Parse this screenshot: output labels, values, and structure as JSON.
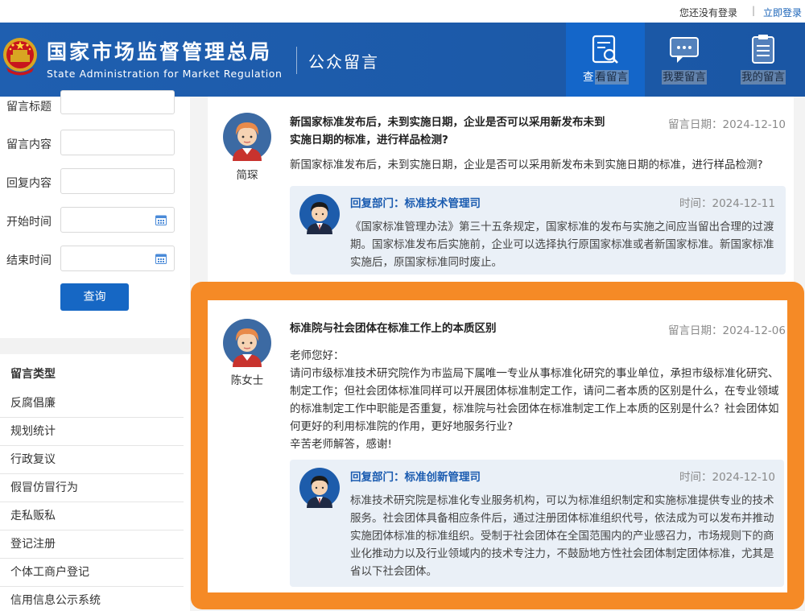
{
  "topbar": {
    "not_logged_in": "您还没有登录",
    "separator": "|",
    "login_link": "立即登录"
  },
  "header": {
    "title_cn": "国家市场监督管理总局",
    "title_en": "State Administration for Market Regulation",
    "section": "公众留言",
    "nav": [
      {
        "label_part1": "查",
        "label_part2": "看留言",
        "icon": "search-document-icon"
      },
      {
        "label": "我要留言",
        "icon": "chat-bubble-icon"
      },
      {
        "label": "我的留言",
        "icon": "list-document-icon"
      }
    ]
  },
  "sidebar": {
    "fields": [
      {
        "label": "留言标题",
        "type": "text"
      },
      {
        "label": "留言内容",
        "type": "text"
      },
      {
        "label": "回复内容",
        "type": "text"
      },
      {
        "label": "开始时间",
        "type": "date",
        "icon": "calendar-icon"
      },
      {
        "label": "结束时间",
        "type": "date",
        "icon": "calendar-icon"
      }
    ],
    "query_button": "查询",
    "types_title": "留言类型",
    "types": [
      "反腐倡廉",
      "规划统计",
      "行政复议",
      "假冒仿冒行为",
      "走私贩私",
      "登记注册",
      "个体工商户登记",
      "信用信息公示系统"
    ]
  },
  "messages": [
    {
      "author": "简琛",
      "title": "新国家标准发布后，未到实施日期，企业是否可以采用新发布未到实施日期的标准，进行样品检测?",
      "date": "留言日期：2024-12-10",
      "body": "新国家标准发布后，未到实施日期，企业是否可以采用新发布未到实施日期的标准，进行样品检测?",
      "reply": {
        "dept": "回复部门：标准技术管理司",
        "date": "时间：2024-12-11",
        "body": "《国家标准管理办法》第三十五条规定，国家标准的发布与实施之间应当留出合理的过渡期。国家标准发布后实施前，企业可以选择执行原国家标准或者新国家标准。新国家标准实施后，原国家标准同时废止。"
      }
    },
    {
      "author": "陈女士",
      "title": "标准院与社会团体在标准工作上的本质区别",
      "date": "留言日期：2024-12-06",
      "body_lines": [
        "老师您好：",
        "请问市级标准技术研究院作为市监局下属唯一专业从事标准化研究的事业单位，承担市级标准化研究、制定工作；但社会团体标准同样可以开展团体标准制定工作，请问二者本质的区别是什么，在专业领域的标准制定工作中职能是否重复，标准院与社会团体在标准制定工作上本质的区别是什么？社会团体如何更好的利用标准院的作用，更好地服务行业?",
        "辛苦老师解答，感谢!"
      ],
      "reply": {
        "dept": "回复部门：标准创新管理司",
        "date": "时间：2024-12-10",
        "body": "标准技术研究院是标准化专业服务机构，可以为标准组织制定和实施标准提供专业的技术服务。社会团体具备相应条件后，通过注册团体标准组织代号，依法成为可以发布并推动实施团体标准的标准组织。受制于社会团体在全国范围内的产业感召力，市场规则下的商业化推动力以及行业领域内的技术专注力，不鼓励地方性社会团体制定团体标准，尤其是省以下社会团体。"
      }
    }
  ],
  "colors": {
    "header_blue": "#1d5cab",
    "active_nav": "#1466c9",
    "highlight": "#f58a26",
    "reply_bg": "#eaf0f7",
    "dept_blue": "#1a5bb0"
  }
}
